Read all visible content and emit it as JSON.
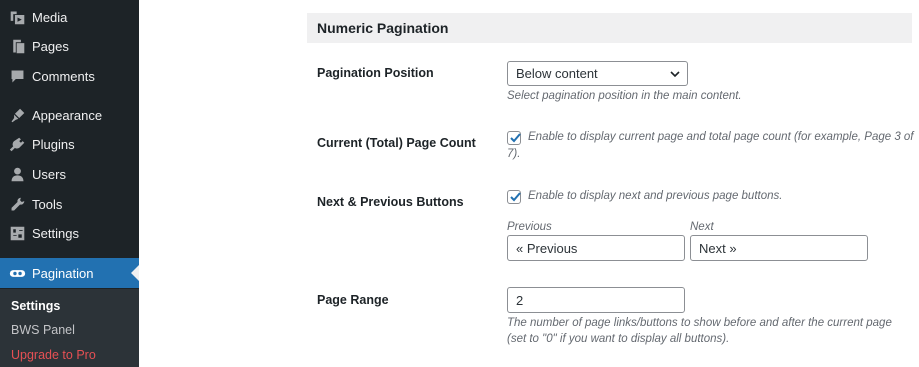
{
  "sidebar": {
    "items": [
      {
        "label": "Media",
        "icon": "media-icon"
      },
      {
        "label": "Pages",
        "icon": "pages-icon"
      },
      {
        "label": "Comments",
        "icon": "comments-icon"
      },
      {
        "label": "Appearance",
        "icon": "appearance-icon"
      },
      {
        "label": "Plugins",
        "icon": "plugins-icon"
      },
      {
        "label": "Users",
        "icon": "users-icon"
      },
      {
        "label": "Tools",
        "icon": "tools-icon"
      },
      {
        "label": "Settings",
        "icon": "settings-icon"
      },
      {
        "label": "Pagination",
        "icon": "pagination-icon",
        "active": true
      }
    ],
    "submenu": [
      {
        "label": "Settings",
        "current": true
      },
      {
        "label": "BWS Panel"
      },
      {
        "label": "Upgrade to Pro",
        "highlight": true
      }
    ]
  },
  "section": {
    "title": "Numeric Pagination"
  },
  "fields": {
    "position": {
      "label": "Pagination Position",
      "value": "Below content",
      "description": "Select pagination position in the main content."
    },
    "page_count": {
      "label": "Current (Total) Page Count",
      "checked": true,
      "description_line1": "Enable to display current page and total page count (for example, Page 3 of",
      "description_line2": "7)."
    },
    "next_prev": {
      "label": "Next & Previous Buttons",
      "checked": true,
      "description": "Enable to display next and previous page buttons.",
      "previous_label": "Previous",
      "previous_value": "« Previous",
      "next_label": "Next",
      "next_value": "Next »"
    },
    "page_range": {
      "label": "Page Range",
      "value": "2",
      "description_line1": "The number of page links/buttons to show before and after the current page",
      "description_line2": "(set to \"0\" if you want to display all buttons)."
    }
  },
  "colors": {
    "sidebar_bg": "#1d2327",
    "active_bg": "#2271b1",
    "submenu_bg": "#2c3338",
    "upgrade": "#e65054",
    "checkbox_tick": "#2271b1"
  }
}
